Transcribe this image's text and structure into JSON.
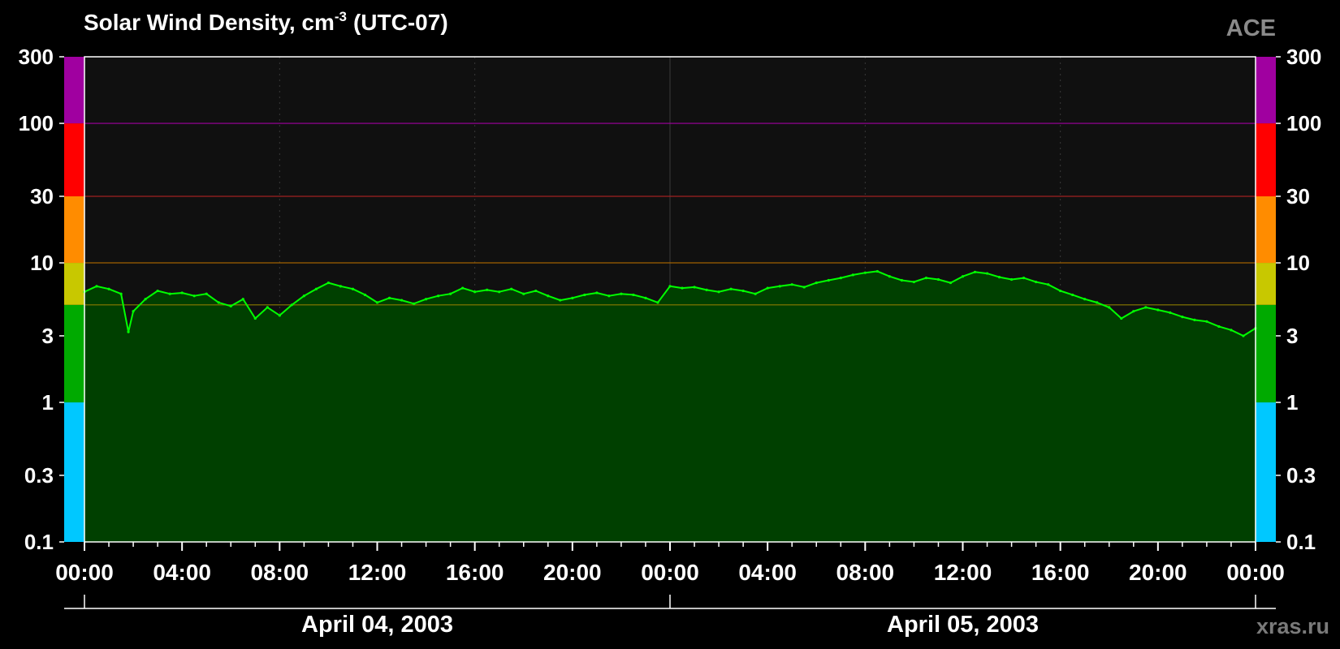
{
  "chart_data": {
    "type": "area",
    "title": "Solar Wind Density, cm",
    "title_superscript": "-3",
    "title_suffix": "(UTC-07)",
    "source_label": "ACE",
    "watermark": "xras.ru",
    "yscale": "log",
    "ylim": [
      0.1,
      300
    ],
    "yticks": [
      {
        "value": 0.1,
        "label": "0.1"
      },
      {
        "value": 0.3,
        "label": "0.3"
      },
      {
        "value": 1,
        "label": "1"
      },
      {
        "value": 3,
        "label": "3"
      },
      {
        "value": 10,
        "label": "10"
      },
      {
        "value": 30,
        "label": "30"
      },
      {
        "value": 100,
        "label": "100"
      },
      {
        "value": 300,
        "label": "300"
      }
    ],
    "xlim_hours": [
      0,
      48
    ],
    "xticks": [
      {
        "hour": 0,
        "label": "00:00"
      },
      {
        "hour": 4,
        "label": "04:00"
      },
      {
        "hour": 8,
        "label": "08:00"
      },
      {
        "hour": 12,
        "label": "12:00"
      },
      {
        "hour": 16,
        "label": "16:00"
      },
      {
        "hour": 20,
        "label": "20:00"
      },
      {
        "hour": 24,
        "label": "00:00"
      },
      {
        "hour": 28,
        "label": "04:00"
      },
      {
        "hour": 32,
        "label": "08:00"
      },
      {
        "hour": 36,
        "label": "12:00"
      },
      {
        "hour": 40,
        "label": "16:00"
      },
      {
        "hour": 44,
        "label": "20:00"
      },
      {
        "hour": 48,
        "label": "00:00"
      }
    ],
    "days": [
      {
        "label": "April 04, 2003",
        "start_hour": 0,
        "end_hour": 24
      },
      {
        "label": "April 05, 2003",
        "start_hour": 24,
        "end_hour": 48
      }
    ],
    "color_bands": [
      {
        "from": 0.1,
        "to": 1,
        "color": "#00c8ff"
      },
      {
        "from": 1,
        "to": 5,
        "color": "#00aa00"
      },
      {
        "from": 5,
        "to": 10,
        "color": "#c8c800"
      },
      {
        "from": 10,
        "to": 30,
        "color": "#ff8c00"
      },
      {
        "from": 30,
        "to": 100,
        "color": "#ff0000"
      },
      {
        "from": 100,
        "to": 300,
        "color": "#a000a0"
      }
    ],
    "threshold_lines": [
      {
        "value": 5,
        "color": "#8a7a00"
      },
      {
        "value": 10,
        "color": "#a06000"
      },
      {
        "value": 30,
        "color": "#a02020"
      },
      {
        "value": 100,
        "color": "#a000a0"
      }
    ],
    "series": [
      {
        "line_color": "#00ff00",
        "fill_color": "#004000",
        "x_hours": [
          0,
          0.5,
          1,
          1.5,
          1.8,
          2,
          2.5,
          3,
          3.5,
          4,
          4.5,
          5,
          5.5,
          6,
          6.5,
          7,
          7.5,
          8,
          8.5,
          9,
          9.5,
          10,
          10.5,
          11,
          11.5,
          12,
          12.5,
          13,
          13.5,
          14,
          14.5,
          15,
          15.5,
          16,
          16.5,
          17,
          17.5,
          18,
          18.5,
          19,
          19.5,
          20,
          20.5,
          21,
          21.5,
          22,
          22.5,
          23,
          23.5,
          24,
          24.5,
          25,
          25.5,
          26,
          26.5,
          27,
          27.5,
          28,
          28.5,
          29,
          29.5,
          30,
          30.5,
          31,
          31.5,
          32,
          32.5,
          33,
          33.5,
          34,
          34.5,
          35,
          35.5,
          36,
          36.5,
          37,
          37.5,
          38,
          38.5,
          39,
          39.5,
          40,
          40.5,
          41,
          41.5,
          42,
          42.5,
          43,
          43.5,
          44,
          44.5,
          45,
          45.5,
          46,
          46.5,
          47,
          47.5,
          48
        ],
        "y": [
          6.2,
          6.8,
          6.5,
          6.0,
          3.2,
          4.5,
          5.5,
          6.3,
          6.0,
          6.1,
          5.8,
          6.0,
          5.2,
          4.9,
          5.5,
          4.0,
          4.8,
          4.2,
          5.0,
          5.8,
          6.5,
          7.2,
          6.8,
          6.5,
          5.9,
          5.2,
          5.6,
          5.4,
          5.1,
          5.5,
          5.8,
          6.0,
          6.6,
          6.2,
          6.4,
          6.2,
          6.5,
          6.0,
          6.3,
          5.8,
          5.4,
          5.6,
          5.9,
          6.1,
          5.8,
          6.0,
          5.9,
          5.6,
          5.2,
          6.8,
          6.6,
          6.7,
          6.4,
          6.2,
          6.5,
          6.3,
          6.0,
          6.6,
          6.8,
          7.0,
          6.7,
          7.2,
          7.5,
          7.8,
          8.2,
          8.5,
          8.7,
          8.0,
          7.5,
          7.3,
          7.8,
          7.6,
          7.2,
          8.0,
          8.6,
          8.4,
          7.9,
          7.6,
          7.8,
          7.3,
          7.0,
          6.3,
          5.9,
          5.5,
          5.2,
          4.8,
          4.0,
          4.5,
          4.8,
          4.6,
          4.4,
          4.1,
          3.9,
          3.8,
          3.5,
          3.3,
          3.0,
          3.4,
          3.2
        ]
      }
    ],
    "grid": true
  }
}
